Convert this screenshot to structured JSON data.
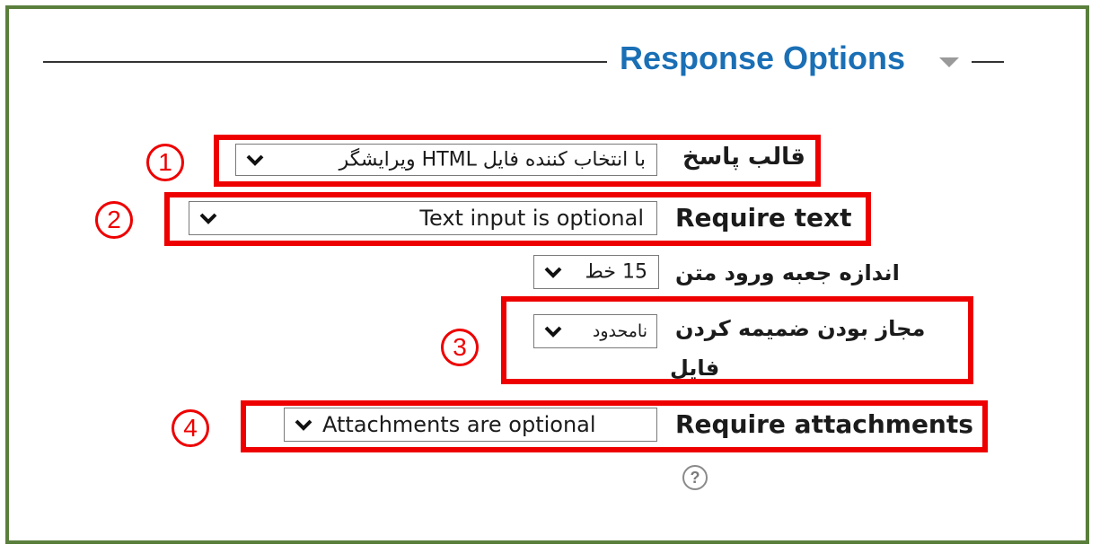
{
  "section": {
    "title": "Response Options",
    "collapse_icon": "caret-down-icon"
  },
  "fields": {
    "response_format": {
      "label": "قالب پاسخ",
      "value": "ویرایشگر HTML با انتخاب کننده فایل",
      "marker": "1"
    },
    "require_text": {
      "label": "Require text",
      "value": "Text input is optional",
      "marker": "2"
    },
    "input_box_size": {
      "label": "اندازه جعبه ورود متن",
      "value": "15 خط"
    },
    "allow_attachments": {
      "label": "مجاز بودن ضمیمه کردن",
      "label_line2": "فایل",
      "value": "نامحدود",
      "marker": "3"
    },
    "require_attachments": {
      "label": "Require attachments",
      "value": "Attachments are optional",
      "marker": "4"
    }
  },
  "help_icon": "question-circle-icon",
  "colors": {
    "frame": "#5a7f3c",
    "title": "#1a6fb5",
    "highlight": "#ee0000"
  }
}
